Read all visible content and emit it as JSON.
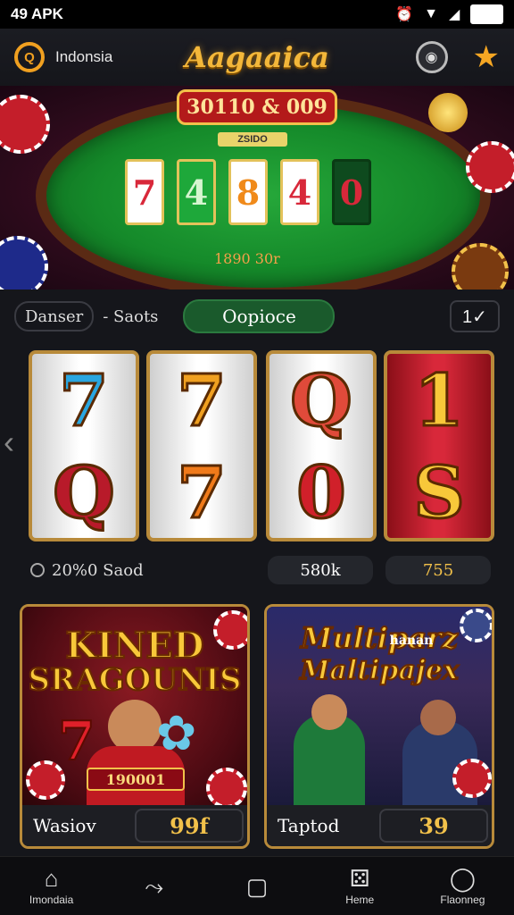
{
  "status_bar": {
    "left_text": "49 APK",
    "battery": "100"
  },
  "app_bar": {
    "region": "Indonsia",
    "brand": "Aagaaica"
  },
  "hero": {
    "jackpot": "30110 & 009",
    "tag": "ZSIDO",
    "cards": [
      "7",
      "4",
      "8",
      "4",
      "0"
    ],
    "sub": "1890 30r"
  },
  "filters": {
    "chip_label": "Danser",
    "separator_text": "- Saots",
    "active_label": "Oopioce",
    "filter_button": "1✓"
  },
  "reels": [
    {
      "top": "7",
      "bottom": "Q"
    },
    {
      "top": "7",
      "bottom": "7"
    },
    {
      "top": "Q",
      "bottom": "0"
    },
    {
      "top": "1",
      "bottom": "S"
    }
  ],
  "stats": {
    "left": "20%0 Saod",
    "middle": "580k",
    "right": "755"
  },
  "cards": [
    {
      "title_line1": "KINED",
      "title_line2": "SRAGOUNIS",
      "price_tag": "190001",
      "label": "Wasiov",
      "value": "99f"
    },
    {
      "title_line1": "Multiparz",
      "title_line2": "Maltipajex",
      "subtitle": "hanan",
      "label": "Taptod",
      "value": "39"
    }
  ],
  "bottom_nav": [
    {
      "icon": "home-icon",
      "label": "Imondaia"
    },
    {
      "icon": "route-icon",
      "label": ""
    },
    {
      "icon": "square-icon",
      "label": ""
    },
    {
      "icon": "dice-icon",
      "label": "Heme"
    },
    {
      "icon": "circle-icon",
      "label": "Flaonneg"
    }
  ],
  "colors": {
    "accent_gold": "#f2c14a",
    "green_pill": "#1a5a2c",
    "background": "#15161b"
  }
}
